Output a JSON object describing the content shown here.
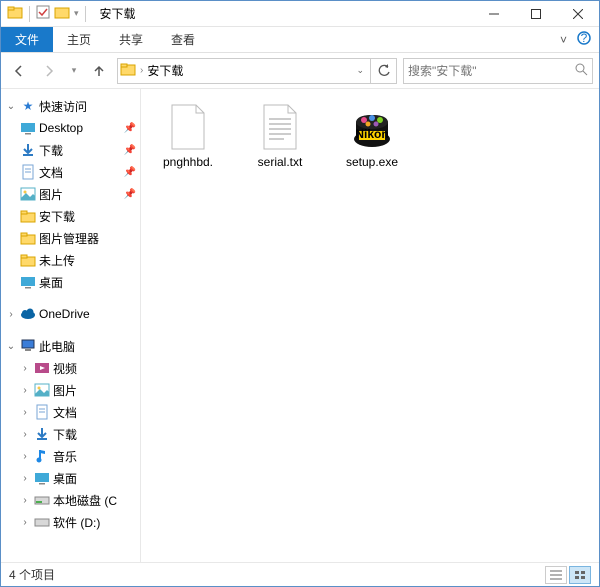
{
  "title": "安下载",
  "ribbon": {
    "file": "文件",
    "tabs": [
      "主页",
      "共享",
      "查看"
    ]
  },
  "address": {
    "folder": "安下载",
    "arrow": "›"
  },
  "search": {
    "placeholder": "搜索\"安下载\""
  },
  "sidebar": {
    "quickaccess": "快速访问",
    "quickitems": [
      {
        "label": "Desktop",
        "pinned": true
      },
      {
        "label": "下载",
        "pinned": true
      },
      {
        "label": "文档",
        "pinned": true
      },
      {
        "label": "图片",
        "pinned": true
      },
      {
        "label": "安下载",
        "pinned": false
      },
      {
        "label": "图片管理器",
        "pinned": false
      },
      {
        "label": "未上传",
        "pinned": false
      },
      {
        "label": "桌面",
        "pinned": false
      }
    ],
    "onedrive": "OneDrive",
    "thispc": "此电脑",
    "pcitems": [
      "视频",
      "图片",
      "文档",
      "下载",
      "音乐",
      "桌面",
      "本地磁盘 (C",
      "软件 (D:)"
    ]
  },
  "files": [
    {
      "name": "pnghhbd.",
      "type": "blank"
    },
    {
      "name": "serial.txt",
      "type": "txt"
    },
    {
      "name": "setup.exe",
      "type": "nikon"
    }
  ],
  "status": "4 个项目"
}
